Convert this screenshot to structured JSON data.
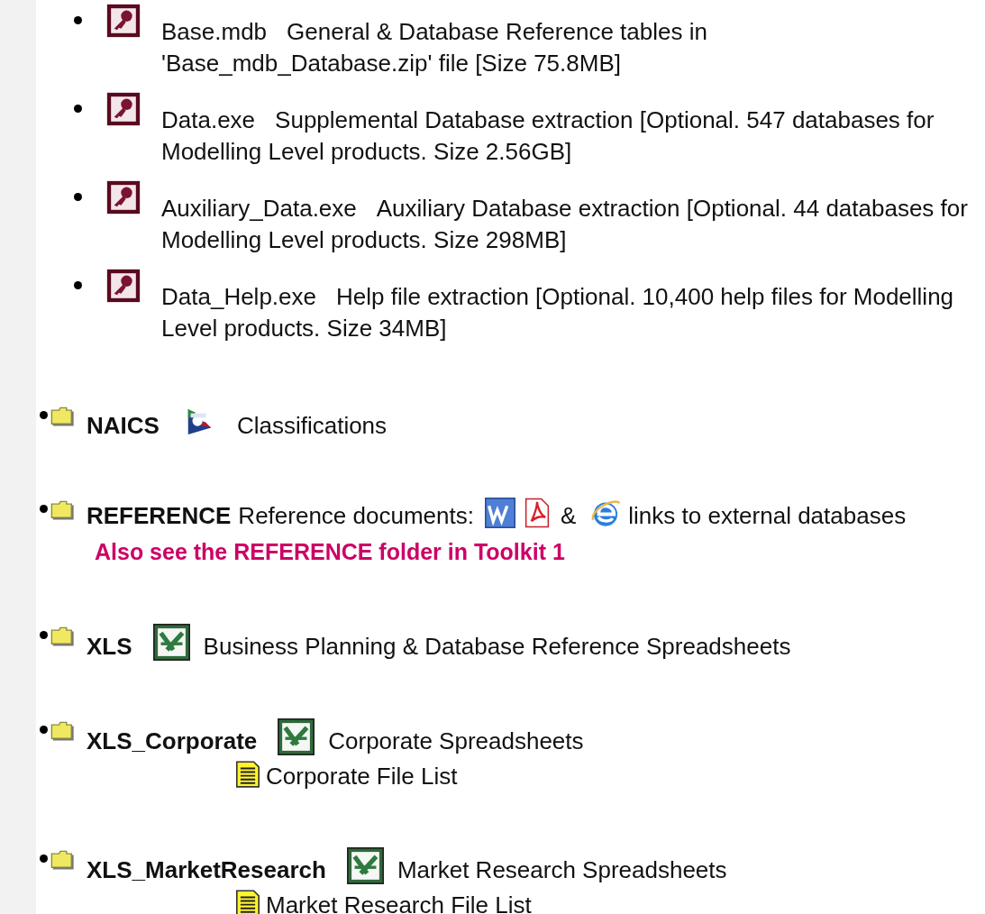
{
  "files": [
    {
      "name": "Base.mdb",
      "description": "General & Database Reference tables in 'Base_mdb_Database.zip' file [Size 75.8MB]"
    },
    {
      "name": "Data.exe",
      "description": "Supplemental Database extraction [Optional. 547 databases for Modelling Level products. Size 2.56GB]"
    },
    {
      "name": "Auxiliary_Data.exe",
      "description": "Auxiliary Database extraction [Optional. 44 databases for Modelling Level products. Size 298MB]"
    },
    {
      "name": "Data_Help.exe",
      "description": "Help file extraction [Optional. 10,400 help files for Modelling Level products. Size 34MB]"
    }
  ],
  "folders": [
    {
      "name": "NAICS",
      "segments": [
        {
          "kind": "logo"
        },
        {
          "kind": "text",
          "text": "Classifications"
        }
      ]
    },
    {
      "name": "REFERENCE",
      "segments": [
        {
          "kind": "text",
          "text": "Reference documents:"
        },
        {
          "kind": "doc"
        },
        {
          "kind": "pdf"
        },
        {
          "kind": "text",
          "text": "&"
        },
        {
          "kind": "web"
        },
        {
          "kind": "text",
          "text": "links to external databases"
        }
      ],
      "note": "Also see the REFERENCE folder in Toolkit 1"
    },
    {
      "name": "XLS",
      "segments": [
        {
          "kind": "sheet"
        },
        {
          "kind": "text",
          "text": "Business Planning & Database Reference Spreadsheets"
        }
      ]
    },
    {
      "name": "XLS_Corporate",
      "segments": [
        {
          "kind": "sheet"
        },
        {
          "kind": "text",
          "text": "Corporate Spreadsheets"
        }
      ],
      "file_list": "Corporate File List"
    },
    {
      "name": "XLS_MarketResearch",
      "segments": [
        {
          "kind": "sheet"
        },
        {
          "kind": "text",
          "text": "Market Research Spreadsheets"
        }
      ],
      "file_list": "Market Research File List"
    }
  ]
}
